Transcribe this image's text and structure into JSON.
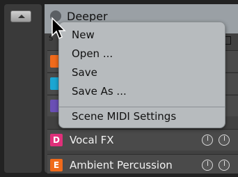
{
  "panel": {
    "title": "Deeper",
    "column_label": "S"
  },
  "menu": {
    "items": [
      {
        "label": "New"
      },
      {
        "label": "Open ..."
      },
      {
        "label": "Save"
      },
      {
        "label": "Save As ..."
      },
      {
        "label": "Scene MIDI Settings"
      }
    ]
  },
  "rows": [
    {
      "badge": "",
      "badge_color": "#f06a1b",
      "label": ""
    },
    {
      "badge": "",
      "badge_color": "#1aa6d3",
      "label": ""
    },
    {
      "badge": "",
      "badge_color": "#6a4fb5",
      "label": ""
    },
    {
      "badge": "D",
      "badge_color": "#e0307a",
      "label": "Vocal FX"
    },
    {
      "badge": "E",
      "badge_color": "#f06a1b",
      "label": "Ambient Percussion"
    }
  ],
  "colors": {
    "menu_background": "#b7bbbe",
    "header_background": "#9aa0a5",
    "row_background": "#4a4a4a"
  }
}
